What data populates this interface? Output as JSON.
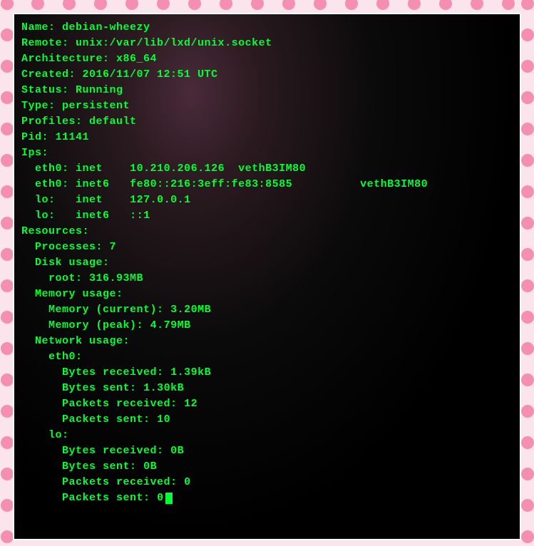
{
  "container": {
    "name_label": "Name:",
    "name_value": "debian-wheezy",
    "remote_label": "Remote:",
    "remote_value": "unix:/var/lib/lxd/unix.socket",
    "arch_label": "Architecture:",
    "arch_value": "x86_64",
    "created_label": "Created:",
    "created_value": "2016/11/07 12:51 UTC",
    "status_label": "Status:",
    "status_value": "Running",
    "type_label": "Type:",
    "type_value": "persistent",
    "profiles_label": "Profiles:",
    "profiles_value": "default",
    "pid_label": "Pid:",
    "pid_value": "11141"
  },
  "ips": {
    "header": "Ips:",
    "rows": [
      {
        "iface": "eth0:",
        "family": "inet",
        "addr": "10.210.206.126",
        "parent": "vethB3IM80"
      },
      {
        "iface": "eth0:",
        "family": "inet6",
        "addr": "fe80::216:3eff:fe83:8585",
        "parent": "vethB3IM80"
      },
      {
        "iface": "lo:",
        "family": "inet",
        "addr": "127.0.0.1",
        "parent": ""
      },
      {
        "iface": "lo:",
        "family": "inet6",
        "addr": "::1",
        "parent": ""
      }
    ]
  },
  "resources": {
    "header": "Resources:",
    "processes_label": "Processes:",
    "processes_value": "7",
    "disk": {
      "header": "Disk usage:",
      "root_label": "root:",
      "root_value": "316.93MB"
    },
    "memory": {
      "header": "Memory usage:",
      "current_label": "Memory (current):",
      "current_value": "3.20MB",
      "peak_label": "Memory (peak):",
      "peak_value": "4.79MB"
    },
    "network": {
      "header": "Network usage:",
      "interfaces": [
        {
          "name": "eth0:",
          "bytes_rx_label": "Bytes received:",
          "bytes_rx_value": "1.39kB",
          "bytes_tx_label": "Bytes sent:",
          "bytes_tx_value": "1.30kB",
          "pkts_rx_label": "Packets received:",
          "pkts_rx_value": "12",
          "pkts_tx_label": "Packets sent:",
          "pkts_tx_value": "10"
        },
        {
          "name": "lo:",
          "bytes_rx_label": "Bytes received:",
          "bytes_rx_value": "0B",
          "bytes_tx_label": "Bytes sent:",
          "bytes_tx_value": "0B",
          "pkts_rx_label": "Packets received:",
          "pkts_rx_value": "0",
          "pkts_tx_label": "Packets sent:",
          "pkts_tx_value": "0"
        }
      ]
    }
  }
}
